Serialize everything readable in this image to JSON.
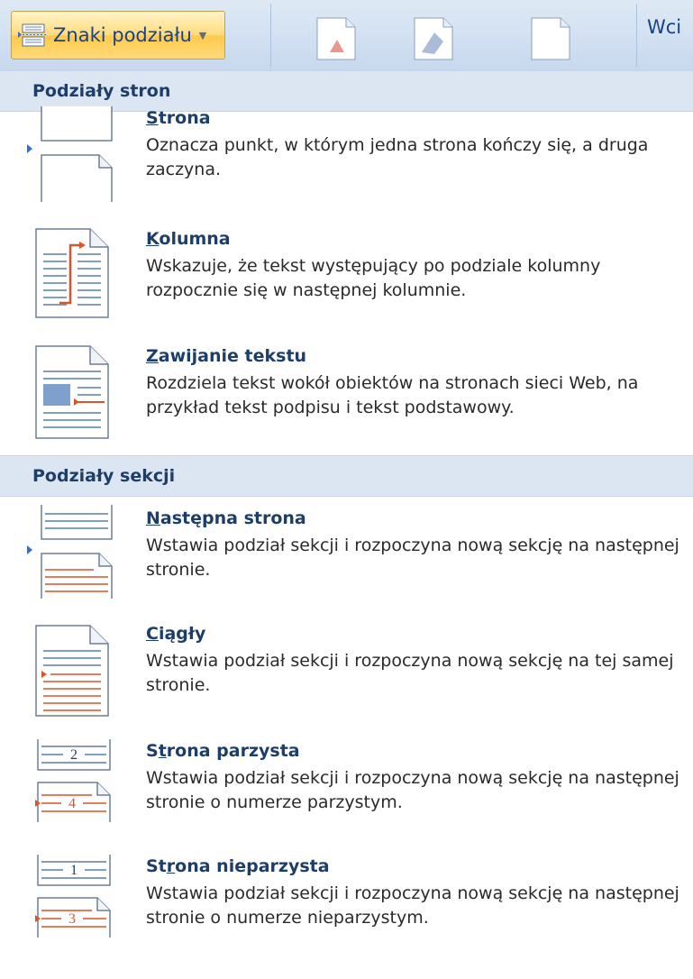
{
  "ribbon": {
    "dropdown_label": "Znaki podziału",
    "partial_label": "Wci",
    "icons": [
      "page-break-icon",
      "page-setup-icon",
      "watermark-icon",
      "page-color-icon"
    ]
  },
  "sections": [
    {
      "header": "Podziały stron",
      "items": [
        {
          "key": "S",
          "rest": "trona",
          "desc": "Oznacza punkt, w którym jedna strona kończy się, a druga zaczyna.",
          "icon": "page-break-icon"
        },
        {
          "key": "K",
          "rest": "olumna",
          "desc": "Wskazuje, że tekst występujący po podziale kolumny rozpocznie się w następnej kolumnie.",
          "icon": "column-break-icon"
        },
        {
          "key": "Z",
          "rest": "awijanie tekstu",
          "desc": "Rozdziela tekst wokół obiektów na stronach sieci Web, na przykład tekst podpisu i tekst podstawowy.",
          "icon": "text-wrapping-icon"
        }
      ]
    },
    {
      "header": "Podziały sekcji",
      "items": [
        {
          "key": "N",
          "rest": "astępna strona",
          "desc": "Wstawia podział sekcji i rozpoczyna nową sekcję na następnej stronie.",
          "icon": "next-page-icon"
        },
        {
          "key": "C",
          "rest": "iągły",
          "desc": "Wstawia podział sekcji i rozpoczyna nową sekcję na tej samej stronie.",
          "icon": "continuous-icon"
        },
        {
          "pre": "S",
          "key": "t",
          "rest": "rona parzysta",
          "desc": "Wstawia podział sekcji i rozpoczyna nową sekcję na następnej stronie o numerze parzystym.",
          "icon": "even-page-icon",
          "num_top": "2",
          "num_bottom": "4"
        },
        {
          "pre": "St",
          "key": "r",
          "rest": "ona nieparzysta",
          "desc": "Wstawia podział sekcji i rozpoczyna nową sekcję na następnej stronie o numerze nieparzystym.",
          "icon": "odd-page-icon",
          "num_top": "1",
          "num_bottom": "3"
        }
      ]
    }
  ],
  "colors": {
    "accent": "#15428b",
    "title": "#1e3e6a",
    "header_bg": "#dce6f2",
    "highlight": "#ffd97a",
    "red_line": "#d9542b"
  }
}
